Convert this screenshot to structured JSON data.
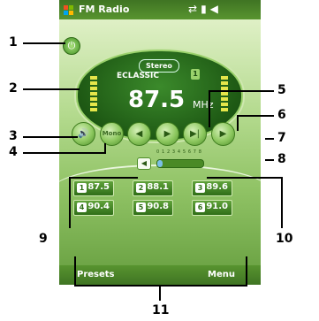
{
  "app": {
    "title": "FM Radio"
  },
  "radio": {
    "stereo_label": "Stereo",
    "station_name": "ECLASSIC",
    "preset_indicator": "1",
    "frequency": "87.5",
    "unit": "MHz"
  },
  "controls": {
    "mono_label": "Mono"
  },
  "volume": {
    "scale": "0 1 2 3 4 5 6 7 8",
    "level": 0.12
  },
  "presets": [
    {
      "num": "1",
      "freq": "87.5"
    },
    {
      "num": "2",
      "freq": "88.1"
    },
    {
      "num": "3",
      "freq": "89.6"
    },
    {
      "num": "4",
      "freq": "90.4"
    },
    {
      "num": "5",
      "freq": "90.8"
    },
    {
      "num": "6",
      "freq": "91.0"
    }
  ],
  "softkeys": {
    "left": "Presets",
    "right": "Menu"
  },
  "callouts": [
    "1",
    "2",
    "3",
    "4",
    "5",
    "6",
    "7",
    "8",
    "9",
    "10",
    "11"
  ],
  "colors": {
    "accent": "#6a9c39",
    "display": "#1e5914"
  }
}
